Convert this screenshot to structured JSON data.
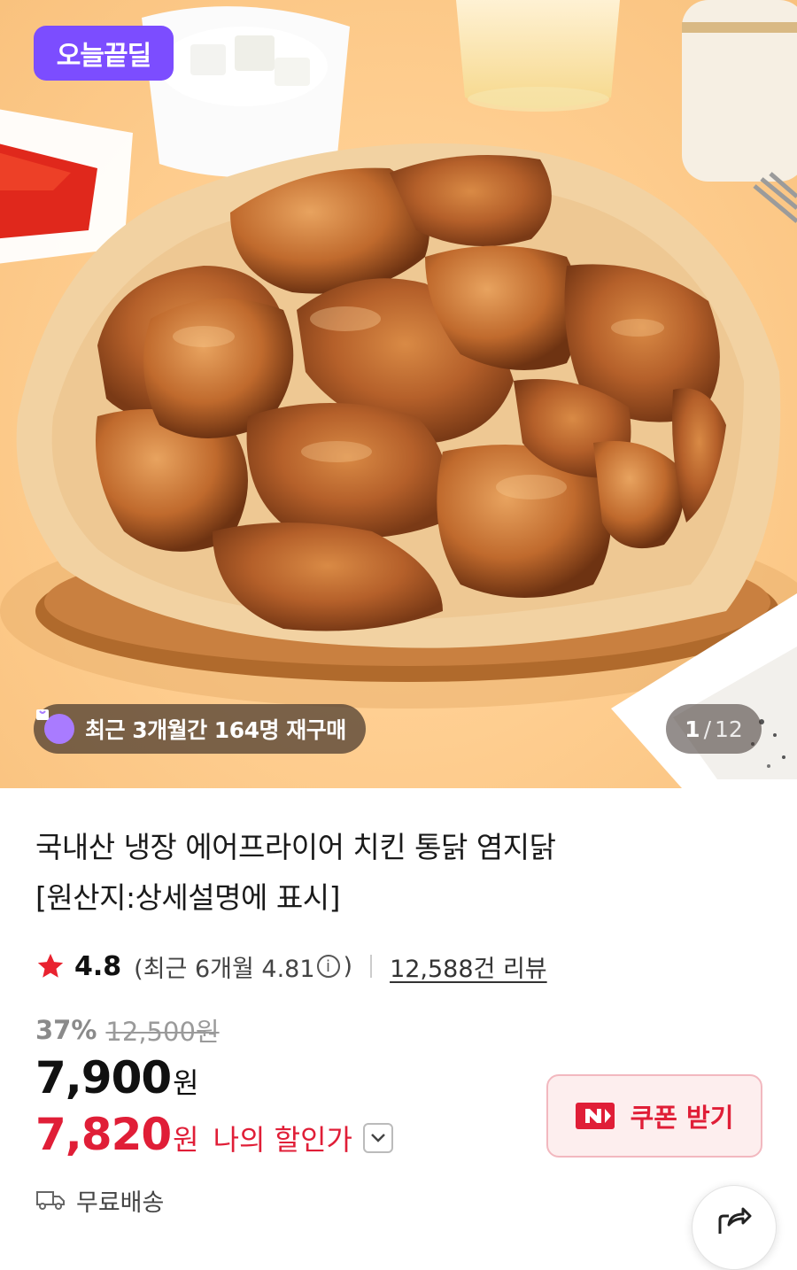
{
  "hero": {
    "deal_badge": "오늘끝딜",
    "repurchase_text": "최근 3개월간 164명 재구매",
    "page_current": "1",
    "page_separator": "/",
    "page_total": "12",
    "image_subject": "roasted chicken pieces on wooden plate with parchment"
  },
  "product": {
    "title_line1": "국내산 냉장 에어프라이어 치킨 통닭 염지닭",
    "title_line2": "[원산지:상세설명에 표시]",
    "rating": "4.8",
    "rating_recent_prefix": "(최근 6개월 4.81",
    "rating_recent_suffix": ")",
    "info_icon_glyph": "i",
    "review_count": "12,588건 리뷰",
    "discount_percent": "37%",
    "original_price": "12,500원",
    "price_number": "7,900",
    "price_unit": "원",
    "my_price_number": "7,820",
    "my_price_unit": "원",
    "my_price_label": "나의 할인가",
    "coupon_label": "쿠폰 받기",
    "shipping_label": "무료배송"
  },
  "icons": {
    "star": "star-icon",
    "info": "info-icon",
    "chevron": "chevron-down-icon",
    "naver": "naver-n-icon",
    "truck": "truck-icon",
    "share": "share-icon",
    "bag": "shopping-bag-icon"
  },
  "colors": {
    "deal_purple": "#7c4dff",
    "price_red": "#e01e37",
    "star_red": "#e9222f",
    "coupon_bg": "#fdeeee"
  }
}
